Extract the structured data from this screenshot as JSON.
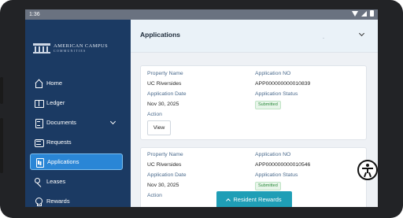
{
  "status_bar": {
    "time": "1:36"
  },
  "brand": {
    "line1": "AMERICAN CAMPUS",
    "line2": "COMMUNITIES"
  },
  "sidebar": {
    "items": [
      {
        "label": "Home",
        "icon": "home-icon"
      },
      {
        "label": "Ledger",
        "icon": "ledger-icon"
      },
      {
        "label": "Documents",
        "icon": "document-icon"
      },
      {
        "label": "Requests",
        "icon": "requests-icon"
      },
      {
        "label": "Applications",
        "icon": "applications-icon",
        "active": true
      },
      {
        "label": "Leases",
        "icon": "key-icon"
      },
      {
        "label": "Rewards",
        "icon": "rewards-icon"
      }
    ]
  },
  "main": {
    "title": "Applications",
    "labels": {
      "property_name": "Property Name",
      "application_no": "Application NO",
      "application_date": "Application Date",
      "application_status": "Application Status",
      "action": "Action"
    },
    "applications": [
      {
        "property_name": "UC Riversides",
        "application_no": "APP000000000010839",
        "application_date": "Nov 30, 2025",
        "status": "Submitted",
        "action_label": "View"
      },
      {
        "property_name": "UC Riversides",
        "application_no": "APP000000000010546",
        "application_date": "Nov 30, 2025",
        "status": "Submitted"
      }
    ]
  },
  "resident_rewards": {
    "label": "Resident Rewards"
  },
  "colors": {
    "sidebar_bg": "#1b3a63",
    "active_item": "#2a86d6",
    "status_green": "#2e8b3e",
    "rewards_button": "#1f9eb6"
  }
}
